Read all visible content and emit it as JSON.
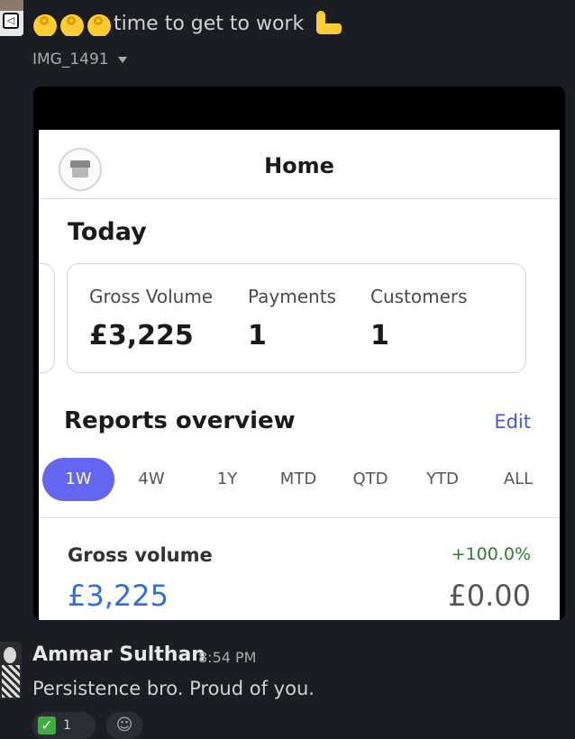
{
  "message1": {
    "text": "time to get to work",
    "emojis": [
      "ok-hand",
      "ok-hand",
      "ok-hand",
      "flexed-biceps"
    ],
    "attachment_name": "IMG_1491"
  },
  "phone": {
    "header_title": "Home",
    "today_label": "Today",
    "stats": [
      {
        "label": "Gross Volume",
        "value": "£3,225"
      },
      {
        "label": "Payments",
        "value": "1"
      },
      {
        "label": "Customers",
        "value": "1"
      }
    ],
    "reports_title": "Reports overview",
    "edit_label": "Edit",
    "ranges": [
      "1W",
      "4W",
      "1Y",
      "MTD",
      "QTD",
      "YTD",
      "ALL"
    ],
    "active_range": "1W",
    "gross_volume_label": "Gross volume",
    "gross_volume_change": "+100.0%",
    "gross_volume_value": "£3,225",
    "gross_volume_previous": "£0.00"
  },
  "message2": {
    "sender": "Ammar Sulthan",
    "time": "8:54 PM",
    "text": "Persistence bro. Proud of you.",
    "reaction_count": "1"
  },
  "colors": {
    "background": "#1a1d21",
    "accent": "#6266f0",
    "positive": "#2e7d32",
    "link": "#4b56d2"
  }
}
